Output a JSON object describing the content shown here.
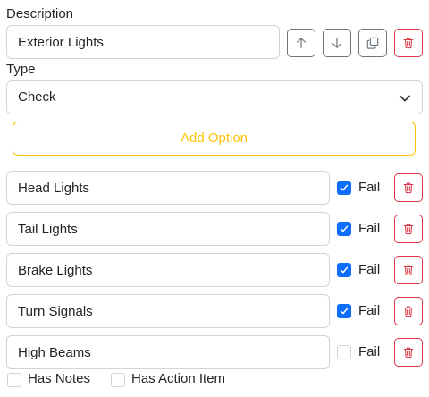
{
  "description": {
    "label": "Description",
    "value": "Exterior Lights"
  },
  "toolbar": {
    "icons": [
      "arrow-up-icon",
      "arrow-down-icon",
      "copy-icon",
      "trash-icon"
    ]
  },
  "type": {
    "label": "Type",
    "selected": "Check"
  },
  "add_option_label": "Add Option",
  "options": [
    {
      "value": "Head Lights",
      "fail_label": "Fail",
      "fail_checked": true
    },
    {
      "value": "Tail Lights",
      "fail_label": "Fail",
      "fail_checked": true
    },
    {
      "value": "Brake Lights",
      "fail_label": "Fail",
      "fail_checked": true
    },
    {
      "value": "Turn Signals",
      "fail_label": "Fail",
      "fail_checked": true
    },
    {
      "value": "High Beams",
      "fail_label": "Fail",
      "fail_checked": false
    }
  ],
  "footer": {
    "has_notes_label": "Has Notes",
    "has_notes_checked": false,
    "has_action_item_label": "Has Action Item",
    "has_action_item_checked": false
  },
  "colors": {
    "warning": "#ffc107",
    "danger": "#dc3545",
    "primary": "#0d6efd",
    "secondary": "#6c757d"
  }
}
